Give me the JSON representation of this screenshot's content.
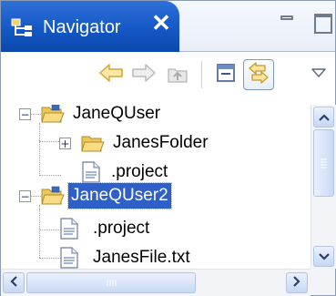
{
  "view": {
    "tab_label": "Navigator",
    "close_glyph": "✕",
    "accent_color": "#1458c6",
    "selection_color": "#2f60c8"
  },
  "toolbar": {
    "buttons": [
      {
        "name": "back-button",
        "icon": "arrow-left-icon",
        "enabled": true
      },
      {
        "name": "forward-button",
        "icon": "arrow-right-icon",
        "enabled": false
      },
      {
        "name": "up-button",
        "icon": "up-folder-icon",
        "enabled": false
      },
      {
        "name": "collapse-all-button",
        "icon": "collapse-all-icon",
        "enabled": true
      },
      {
        "name": "link-with-editor-button",
        "icon": "link-arrows-icon",
        "enabled": true,
        "pressed": true
      },
      {
        "name": "view-menu-button",
        "icon": "triangle-down-icon",
        "enabled": true
      }
    ]
  },
  "tree": {
    "items": [
      {
        "label": "JaneQUser",
        "type": "project",
        "expanded": true,
        "selected": false
      },
      {
        "label": "JanesFolder",
        "type": "folder",
        "expanded": false,
        "selected": false
      },
      {
        "label": ".project",
        "type": "file",
        "selected": false
      },
      {
        "label": "JaneQUser2",
        "type": "project",
        "expanded": true,
        "selected": true
      },
      {
        "label": ".project",
        "type": "file",
        "selected": false
      },
      {
        "label": "JanesFile.txt",
        "type": "file",
        "selected": false
      }
    ]
  }
}
